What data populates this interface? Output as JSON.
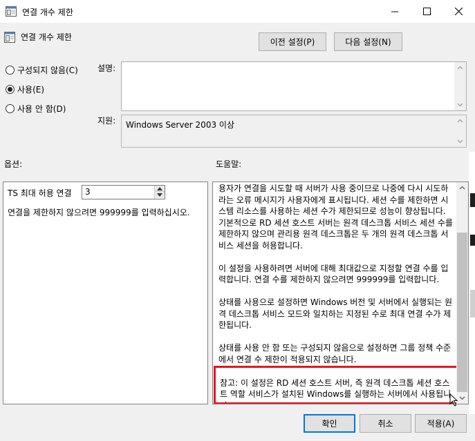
{
  "window": {
    "title": "연결 개수 제한",
    "controls": {
      "minimize": "minimize-icon",
      "maximize": "maximize-icon",
      "close": "close-icon"
    }
  },
  "header": {
    "title": "연결 개수 제한",
    "prev_label": "이전 설정(P)",
    "next_label": "다음 설정(N)"
  },
  "state": {
    "options": [
      {
        "label": "구성되지 않음(C)",
        "checked": false
      },
      {
        "label": "사용(E)",
        "checked": true
      },
      {
        "label": "사용 안 함(D)",
        "checked": false
      }
    ]
  },
  "description": {
    "label": "설명:",
    "value": ""
  },
  "supported": {
    "label": "지원:",
    "value": "Windows Server 2003 이상"
  },
  "options_panel": {
    "heading": "옵션:",
    "ts_label": "TS 최대 허용 연결",
    "ts_value": "3",
    "hint": "연결을 제한하지 않으려면 999999를 입력하십시오."
  },
  "help_panel": {
    "heading": "도움말:",
    "paragraphs": [
      "용자가 연결을 시도할 때 서버가 사용 중이므로 나중에 다시 시도하라는 오류 메시지가 사용자에게 표시됩니다. 세션 수를 제한하면 시스템 리소스를 사용하는 세션 수가 제한되므로 성능이 향상됩니다. 기본적으로 RD 세션 호스트 서버는 원격 데스크톱 서비스 세션 수를 제한하지 않으며 관리용 원격 데스크톱은 두 개의 원격 데스크톱 서비스 세션을 허용합니다.",
      "이 설정을 사용하려면 서버에 대해 최대값으로 지정할 연결 수를 입력합니다. 연결 수를 제한하지 않으려면 999999를 입력합니다.",
      "상태를 사용으로 설정하면 Windows 버전 및 서버에서 실행되는 원격 데스크톱 서비스 모드와 일치하는 지정된 수로 최대 연결 수가 제한됩니다.",
      "상태를 사용 안 함 또는 구성되지 않음으로 설정하면 그룹 정책 수준에서 연결 수 제한이 적용되지 않습니다."
    ],
    "note": "참고: 이 설정은 RD 세션 호스트 서버, 즉 원격 데스크톱 세션 호스트 역할 서비스가 설치된 Windows를 실행하는 서버에서 사용됩니다.",
    "highlight_color": "#e8141f"
  },
  "footer": {
    "ok_label": "확인",
    "cancel_label": "취소",
    "apply_label": "적용(A)"
  }
}
